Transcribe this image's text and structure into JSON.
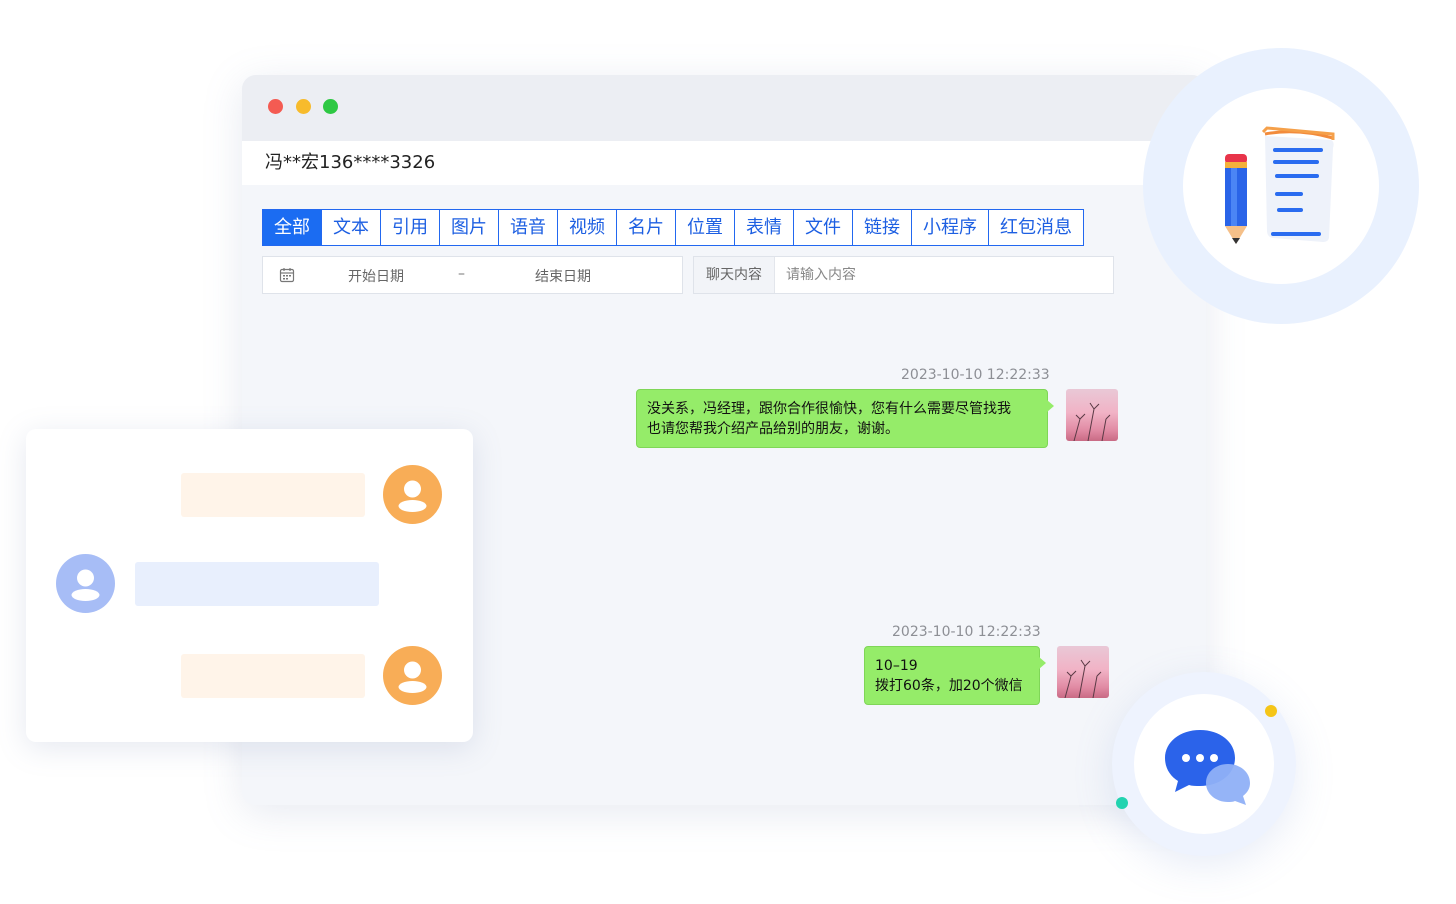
{
  "window": {
    "contact_title": "冯**宏136****3326"
  },
  "tabs": [
    {
      "label": "全部",
      "active": true
    },
    {
      "label": "文本",
      "active": false
    },
    {
      "label": "引用",
      "active": false
    },
    {
      "label": "图片",
      "active": false
    },
    {
      "label": "语音",
      "active": false
    },
    {
      "label": "视频",
      "active": false
    },
    {
      "label": "名片",
      "active": false
    },
    {
      "label": "位置",
      "active": false
    },
    {
      "label": "表情",
      "active": false
    },
    {
      "label": "文件",
      "active": false
    },
    {
      "label": "链接",
      "active": false
    },
    {
      "label": "小程序",
      "active": false
    },
    {
      "label": "红包消息",
      "active": false
    }
  ],
  "filters": {
    "start_date_placeholder": "开始日期",
    "date_separator": "–",
    "end_date_placeholder": "结束日期",
    "content_label": "聊天内容",
    "content_placeholder": "请输入内容"
  },
  "messages": [
    {
      "time": "2023-10-10 12:22:33",
      "line1": "没关系，冯经理，跟你合作很愉快，您有什么需要尽管找我",
      "line2": "也请您帮我介绍产品给别的朋友，谢谢。"
    },
    {
      "time": "2023-10-10 12:22:33",
      "line1": "10–19",
      "line2": "拨打60条，加20个微信"
    }
  ],
  "colors": {
    "accent": "#1b6cf2",
    "bubble_green": "#95ec69",
    "orange_avatar": "#f8ad57",
    "blue_avatar": "#a7bdf6"
  },
  "icons": {
    "calendar": "calendar-icon",
    "notes": "notes-pencil-icon",
    "chat": "chat-bubbles-icon",
    "user": "user-icon"
  }
}
